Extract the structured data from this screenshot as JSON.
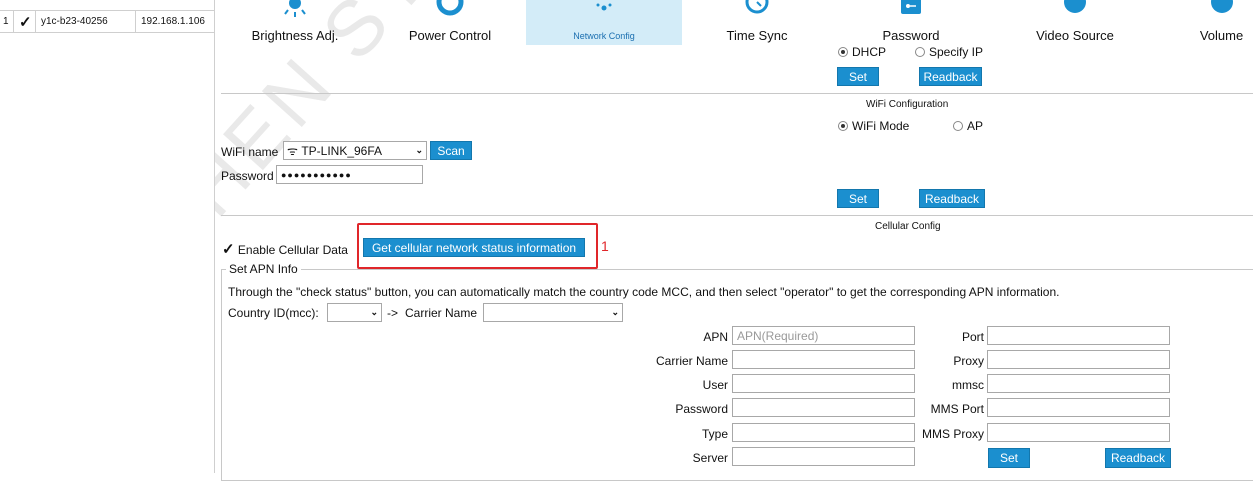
{
  "device_list": {
    "rows": [
      {
        "index": "1",
        "checked": "✓",
        "name": "y1c-b23-40256",
        "ip": "192.168.1.106"
      }
    ]
  },
  "tabs": [
    {
      "label": "Brightness Adj.",
      "icon": "sun-icon",
      "active": false
    },
    {
      "label": "Power Control",
      "icon": "power-icon",
      "active": false
    },
    {
      "label": "Network Config",
      "icon": "network-icon",
      "active": true
    },
    {
      "label": "Time Sync",
      "icon": "clock-icon",
      "active": false
    },
    {
      "label": "Password",
      "icon": "key-icon",
      "active": false
    },
    {
      "label": "Video Source",
      "icon": "video-source-icon",
      "active": false
    },
    {
      "label": "Volume",
      "icon": "volume-icon",
      "active": false
    }
  ],
  "ip_mode": {
    "options": [
      "DHCP",
      "Specify IP"
    ],
    "selected": "DHCP",
    "set_label": "Set",
    "readback_label": "Readback"
  },
  "wifi": {
    "section_title": "WiFi Configuration",
    "modes": [
      "WiFi Mode",
      "AP"
    ],
    "selected_mode": "WiFi Mode",
    "name_label": "WiFi name",
    "wifi_glyph": "ᯤ",
    "name_value": "TP-LINK_96FA",
    "scan_label": "Scan",
    "password_label": "Password",
    "password_value": "●●●●●●●●●●●",
    "set_label": "Set",
    "readback_label": "Readback"
  },
  "cellular": {
    "section_title": "Cellular Config",
    "enable_label": "Enable Cellular Data",
    "enable_checked": "✓",
    "status_button_label": "Get cellular network status information",
    "annotation_number": "1",
    "apn_group_label": "Set APN Info",
    "instructions": "Through the \"check status\" button, you can automatically match the country code MCC, and then select \"operator\" to get the corresponding APN information.",
    "country_label": "Country ID(mcc):",
    "arrow_text": "->",
    "carrier_label": "Carrier Name",
    "country_value": "",
    "carrier_value": ""
  },
  "apn_form": {
    "left_fields": [
      {
        "label": "APN",
        "value": "",
        "placeholder": "APN(Required)"
      },
      {
        "label": "Carrier Name",
        "value": ""
      },
      {
        "label": "User",
        "value": ""
      },
      {
        "label": "Password",
        "value": ""
      },
      {
        "label": "Type",
        "value": ""
      },
      {
        "label": "Server",
        "value": ""
      }
    ],
    "right_fields": [
      {
        "label": "Port",
        "value": ""
      },
      {
        "label": "Proxy",
        "value": ""
      },
      {
        "label": "mmsc",
        "value": ""
      },
      {
        "label": "MMS Port",
        "value": ""
      },
      {
        "label": "MMS Proxy",
        "value": ""
      }
    ],
    "set_label": "Set",
    "readback_label": "Readback"
  },
  "watermark": {
    "text": "SHENZHEN SYSOLUTION",
    "color": "#e6e6e6"
  },
  "colors": {
    "accent": "#1b8fcf",
    "tab_active_bg": "#d3ecf8",
    "highlight": "#e0262a"
  }
}
